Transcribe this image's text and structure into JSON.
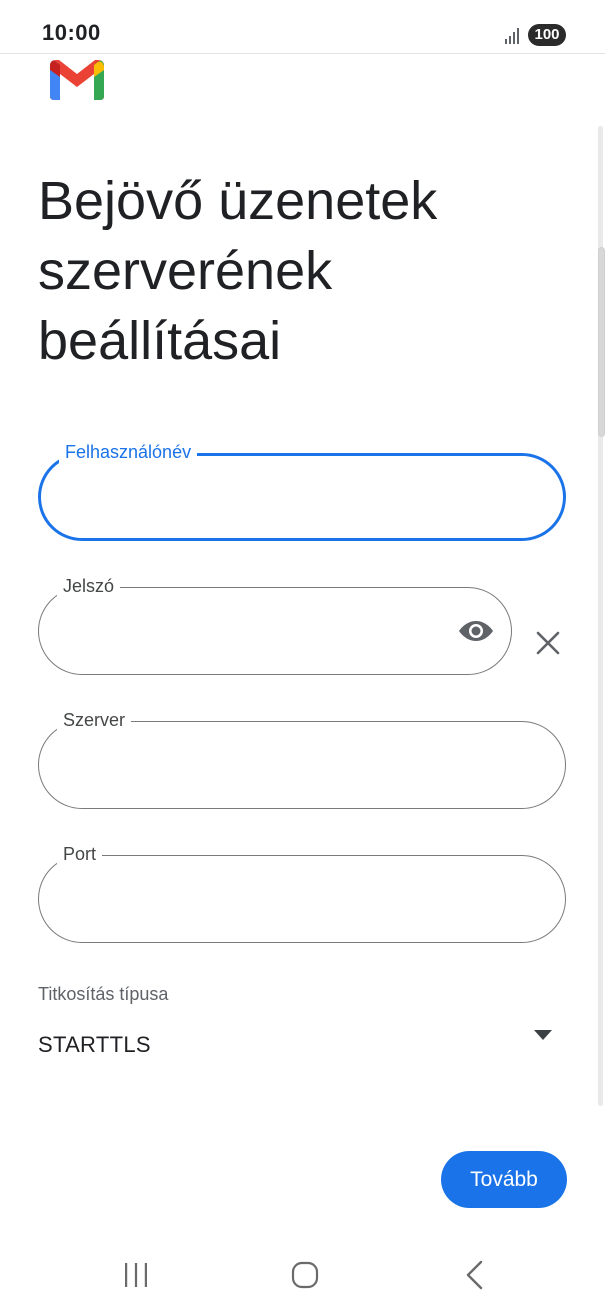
{
  "status_bar": {
    "time": "10:00",
    "battery": "100",
    "icons": [
      "signal-icon",
      "battery-icon"
    ]
  },
  "app": {
    "logo_icon": "gmail-logo-icon"
  },
  "page": {
    "title_line1": "Bejövő üzenetek",
    "title_line2": "szerverének",
    "title_line3": "beállításai"
  },
  "form": {
    "username": {
      "label": "Felhasználónév",
      "value": "",
      "focused": true
    },
    "password": {
      "label": "Jelszó",
      "value": "",
      "toggle_icon": "eye-icon",
      "clear_icon": "close-icon"
    },
    "server": {
      "label": "Szerver",
      "value": ""
    },
    "port": {
      "label": "Port",
      "value": ""
    },
    "encryption": {
      "label": "Titkosítás típusa",
      "selected": "STARTTLS",
      "icon": "dropdown-arrow-icon"
    }
  },
  "actions": {
    "next_label": "Tovább"
  },
  "navigation": {
    "icons": [
      "recents-icon",
      "home-icon",
      "back-icon"
    ]
  },
  "colors": {
    "accent": "#1a73e8",
    "text": "#202124",
    "outline": "#7a7a7a",
    "gmail_red": "#ea4335",
    "gmail_blue": "#4285f4",
    "gmail_green": "#34a853",
    "gmail_yellow": "#fbbc04"
  }
}
